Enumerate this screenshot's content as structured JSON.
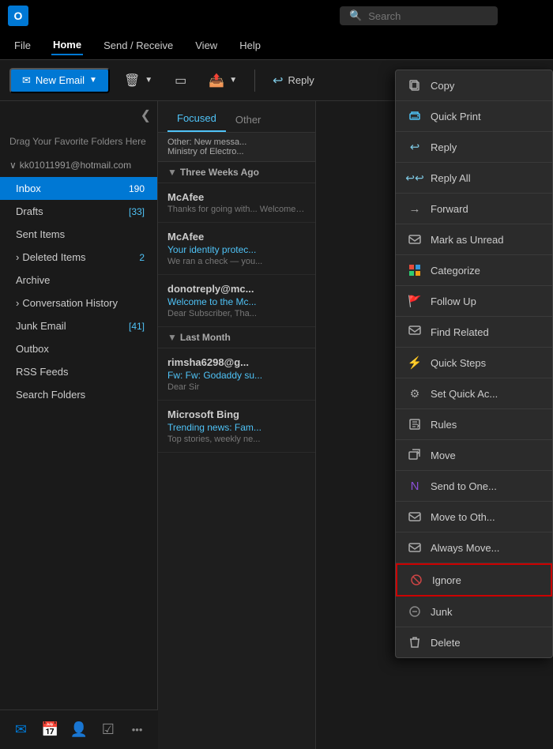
{
  "titleBar": {
    "logoText": "O",
    "searchPlaceholder": "Search"
  },
  "menuBar": {
    "items": [
      {
        "label": "File",
        "active": false
      },
      {
        "label": "Home",
        "active": true
      },
      {
        "label": "Send / Receive",
        "active": false
      },
      {
        "label": "View",
        "active": false
      },
      {
        "label": "Help",
        "active": false
      }
    ]
  },
  "toolbar": {
    "newEmailLabel": "New Email",
    "replyLabel": "Reply"
  },
  "sidebar": {
    "favoriteFolders": "Drag Your Favorite Folders Here",
    "accountEmail": "kk01011991@hotmail.com",
    "folders": [
      {
        "label": "Inbox",
        "count": "190",
        "countType": "number",
        "active": true
      },
      {
        "label": "Drafts",
        "count": "[33]",
        "countType": "bracket",
        "active": false
      },
      {
        "label": "Sent Items",
        "count": "",
        "active": false
      },
      {
        "label": "Deleted Items",
        "count": "2",
        "countType": "number",
        "active": false,
        "hasArrow": true
      },
      {
        "label": "Archive",
        "count": "",
        "active": false
      },
      {
        "label": "Conversation History",
        "count": "",
        "active": false,
        "hasArrow": true
      },
      {
        "label": "Junk Email",
        "count": "[41]",
        "countType": "bracket",
        "active": false
      },
      {
        "label": "Outbox",
        "count": "",
        "active": false
      },
      {
        "label": "RSS Feeds",
        "count": "",
        "active": false
      },
      {
        "label": "Search Folders",
        "count": "",
        "active": false
      }
    ]
  },
  "bottomNav": {
    "items": [
      {
        "icon": "✉",
        "label": "mail",
        "active": true
      },
      {
        "icon": "📅",
        "label": "calendar",
        "active": false
      },
      {
        "icon": "👤",
        "label": "people",
        "active": false
      },
      {
        "icon": "☑",
        "label": "tasks",
        "active": false
      },
      {
        "icon": "•••",
        "label": "more",
        "active": false
      }
    ]
  },
  "emailList": {
    "tabs": [
      {
        "label": "Focused",
        "active": true
      },
      {
        "label": "Other",
        "active": false
      }
    ],
    "otherBanner": "Other: New messa...",
    "otherBannerSub": "Ministry of Electro...",
    "sections": [
      {
        "label": "Three Weeks Ago",
        "emails": [
          {
            "sender": "McAfee",
            "subject": "",
            "preview": "Thanks for going with... Welcome! We're here..."
          },
          {
            "sender": "McAfee",
            "subject": "Your identity protec...",
            "preview": "We ran a check — you..."
          },
          {
            "sender": "donotreply@mc...",
            "subject": "Welcome to the Mc...",
            "preview": "Dear Subscriber, Tha..."
          }
        ]
      },
      {
        "label": "Last Month",
        "emails": [
          {
            "sender": "rimsha6298@g...",
            "subject": "Fw: Fw: Godaddy su...",
            "preview": "Dear Sir"
          },
          {
            "sender": "Microsoft Bing",
            "subject": "Trending news: Fam...",
            "preview": "Top stories, weekly ne..."
          }
        ]
      }
    ]
  },
  "contextMenu": {
    "items": [
      {
        "label": "Copy",
        "iconType": "copy",
        "highlighted": false
      },
      {
        "label": "Quick Print",
        "iconType": "print",
        "highlighted": false
      },
      {
        "label": "Reply",
        "iconType": "reply",
        "highlighted": false
      },
      {
        "label": "Reply All",
        "iconType": "replyall",
        "highlighted": false
      },
      {
        "label": "Forward",
        "iconType": "forward",
        "highlighted": false
      },
      {
        "label": "Mark as Unread",
        "iconType": "envelope",
        "highlighted": false
      },
      {
        "label": "Categorize",
        "iconType": "categorize",
        "highlighted": false
      },
      {
        "label": "Follow Up",
        "iconType": "followup",
        "highlighted": false
      },
      {
        "label": "Find Related",
        "iconType": "findrelated",
        "highlighted": false
      },
      {
        "label": "Quick Steps",
        "iconType": "quicksteps",
        "highlighted": false
      },
      {
        "label": "Set Quick Ac...",
        "iconType": "setquick",
        "highlighted": false
      },
      {
        "label": "Rules",
        "iconType": "rules",
        "highlighted": false
      },
      {
        "label": "Move",
        "iconType": "move",
        "highlighted": false
      },
      {
        "label": "Send to One...",
        "iconType": "sendtoone",
        "highlighted": false
      },
      {
        "label": "Move to Oth...",
        "iconType": "moveother",
        "highlighted": false
      },
      {
        "label": "Always Move...",
        "iconType": "alwaysmove",
        "highlighted": false
      },
      {
        "label": "Ignore",
        "iconType": "ignore",
        "highlighted": true
      },
      {
        "label": "Junk",
        "iconType": "junk",
        "highlighted": false
      },
      {
        "label": "Delete",
        "iconType": "delete",
        "highlighted": false
      }
    ]
  }
}
